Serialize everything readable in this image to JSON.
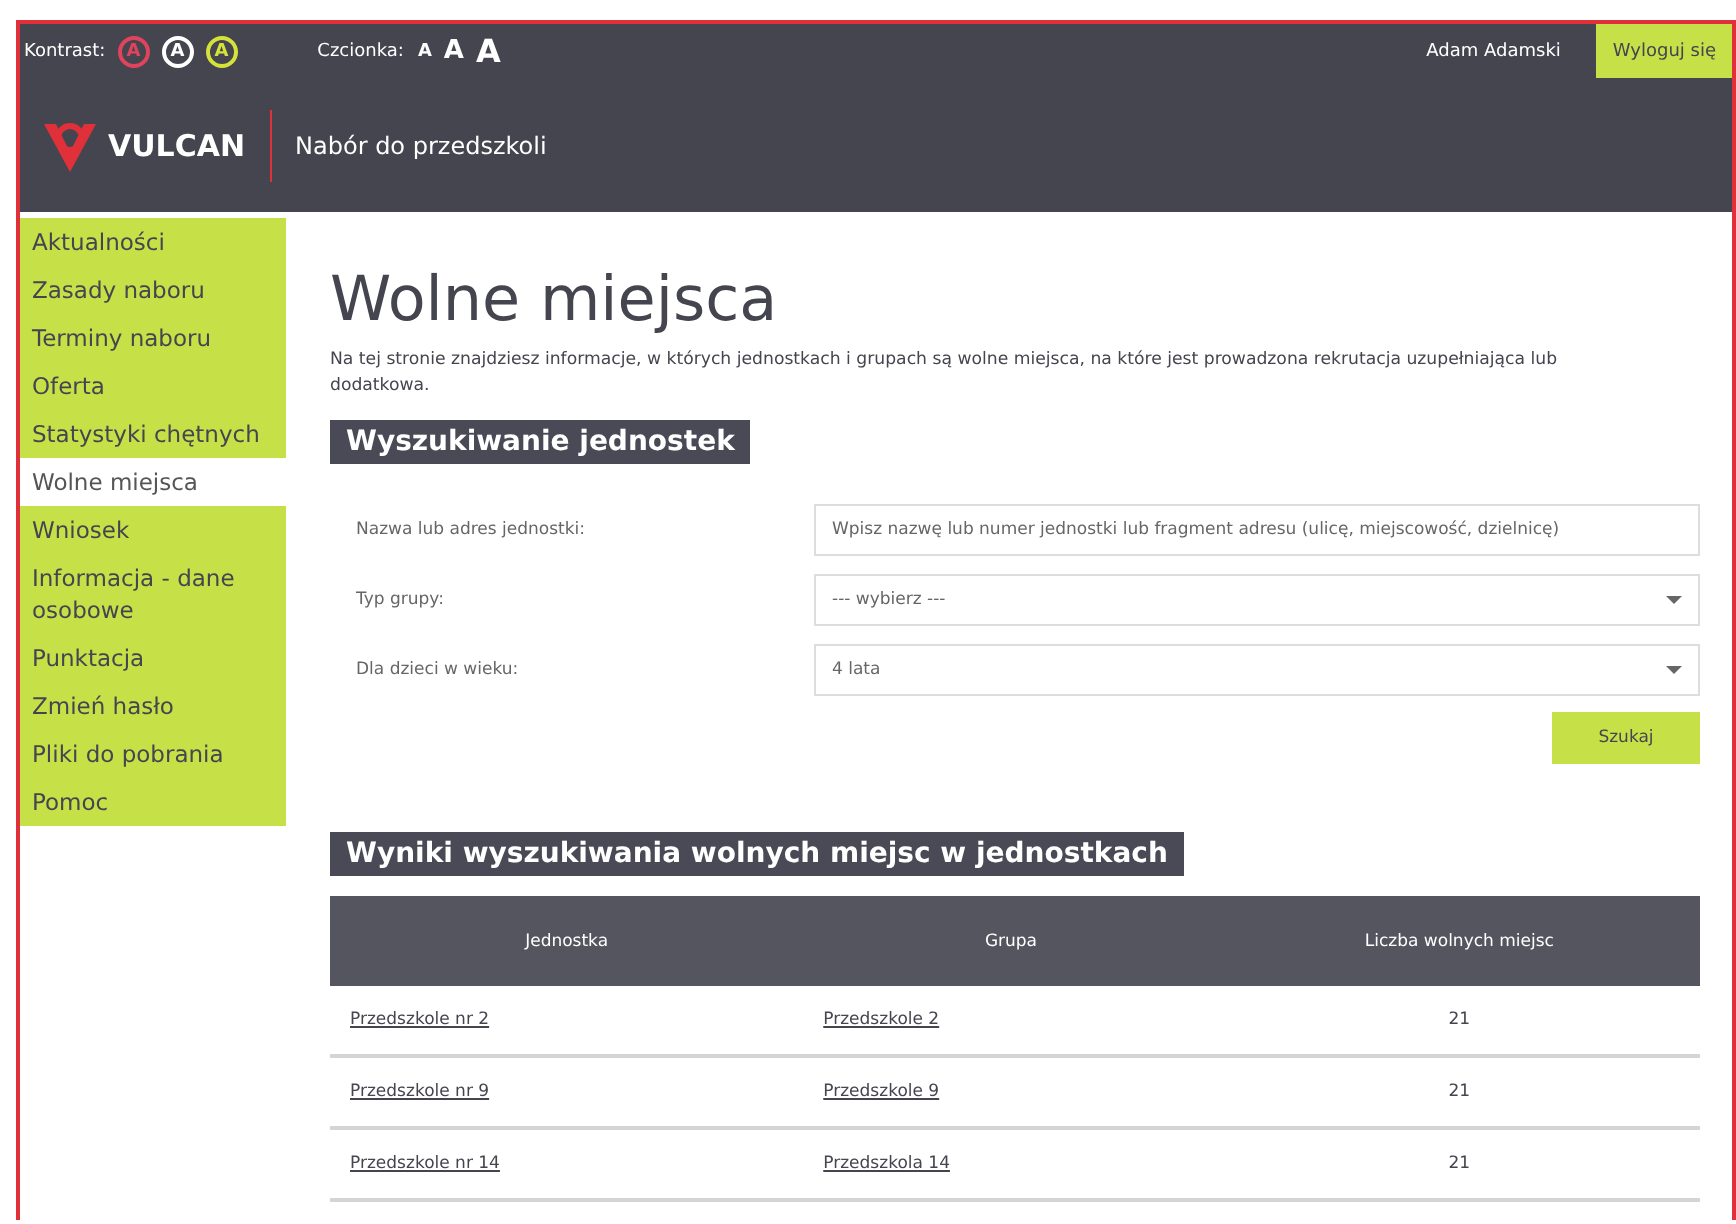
{
  "topbar": {
    "contrast_label": "Kontrast:",
    "contrast_options": [
      {
        "label": "A",
        "color": "#e0445c"
      },
      {
        "label": "A",
        "color": "#ffffff"
      },
      {
        "label": "A",
        "color": "#d4e23a"
      }
    ],
    "font_label": "Czcionka:",
    "font_options": [
      {
        "label": "A",
        "kind": "small"
      },
      {
        "label": "A",
        "kind": "medium"
      },
      {
        "label": "A",
        "kind": "large"
      }
    ],
    "user": "Adam Adamski",
    "logout": "Wyloguj się"
  },
  "header": {
    "logo": "VULCAN",
    "app_title": "Nabór do przedszkoli"
  },
  "sidebar": {
    "items": [
      {
        "label": "Aktualności",
        "selected": false
      },
      {
        "label": "Zasady naboru",
        "selected": false
      },
      {
        "label": "Terminy naboru",
        "selected": false
      },
      {
        "label": "Oferta",
        "selected": false
      },
      {
        "label": "Statystyki chętnych",
        "selected": false
      },
      {
        "label": "Wolne miejsca",
        "selected": true
      },
      {
        "label": "Wniosek",
        "selected": false
      },
      {
        "label": "Informacja - dane osobowe",
        "selected": false
      },
      {
        "label": "Punktacja",
        "selected": false
      },
      {
        "label": "Zmień hasło",
        "selected": false
      },
      {
        "label": "Pliki do pobrania",
        "selected": false
      },
      {
        "label": "Pomoc",
        "selected": false
      }
    ]
  },
  "main": {
    "title": "Wolne miejsca",
    "description": "Na tej stronie znajdziesz informacje, w których jednostkach i grupach są wolne miejsca, na które jest prowadzona rekrutacja uzupełniająca lub dodatkowa.",
    "search_heading": "Wyszukiwanie jednostek",
    "fields": [
      {
        "kind": "text",
        "label": "Nazwa lub adres jednostki:",
        "placeholder": "Wpisz nazwę lub numer jednostki lub fragment adresu (ulicę, miejscowość, dzielnicę)"
      },
      {
        "kind": "select",
        "label": "Typ grupy:",
        "value": "--- wybierz ---"
      },
      {
        "kind": "select",
        "label": "Dla dzieci w wieku:",
        "value": "4 lata"
      }
    ],
    "search_button": "Szukaj",
    "results_heading": "Wyniki wyszukiwania wolnych miejsc w jednostkach",
    "table": {
      "columns": [
        "Jednostka",
        "Grupa",
        "Liczba wolnych miejsc"
      ],
      "rows": [
        [
          "Przedszkole nr 2",
          "Przedszkole 2",
          "21"
        ],
        [
          "Przedszkole nr 9",
          "Przedszkole 9",
          "21"
        ],
        [
          "Przedszkole nr 14",
          "Przedszkola 14",
          "21"
        ]
      ]
    }
  }
}
